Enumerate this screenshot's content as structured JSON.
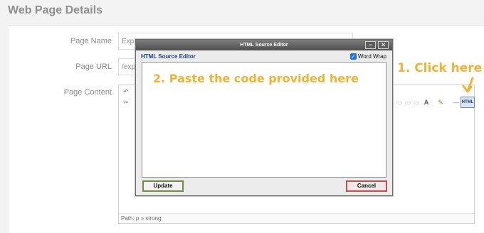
{
  "page": {
    "title": "Web Page Details"
  },
  "form": {
    "page_name_label": "Page Name",
    "page_name_value": "Expl",
    "page_url_label": "Page URL",
    "page_url_value": "/expl",
    "page_content_label": "Page Content"
  },
  "editor": {
    "status_path": "Path: p » strong",
    "html_button_label": "HTML"
  },
  "dialog": {
    "title": "HTML Source Editor",
    "heading": "HTML Source Editor",
    "word_wrap_label": "Word Wrap",
    "word_wrap_checked": true,
    "update_label": "Update",
    "cancel_label": "Cancel"
  },
  "annotations": {
    "step1": "1. Click here",
    "step2": "2. Paste the code provided here",
    "color": "#f2b332"
  }
}
